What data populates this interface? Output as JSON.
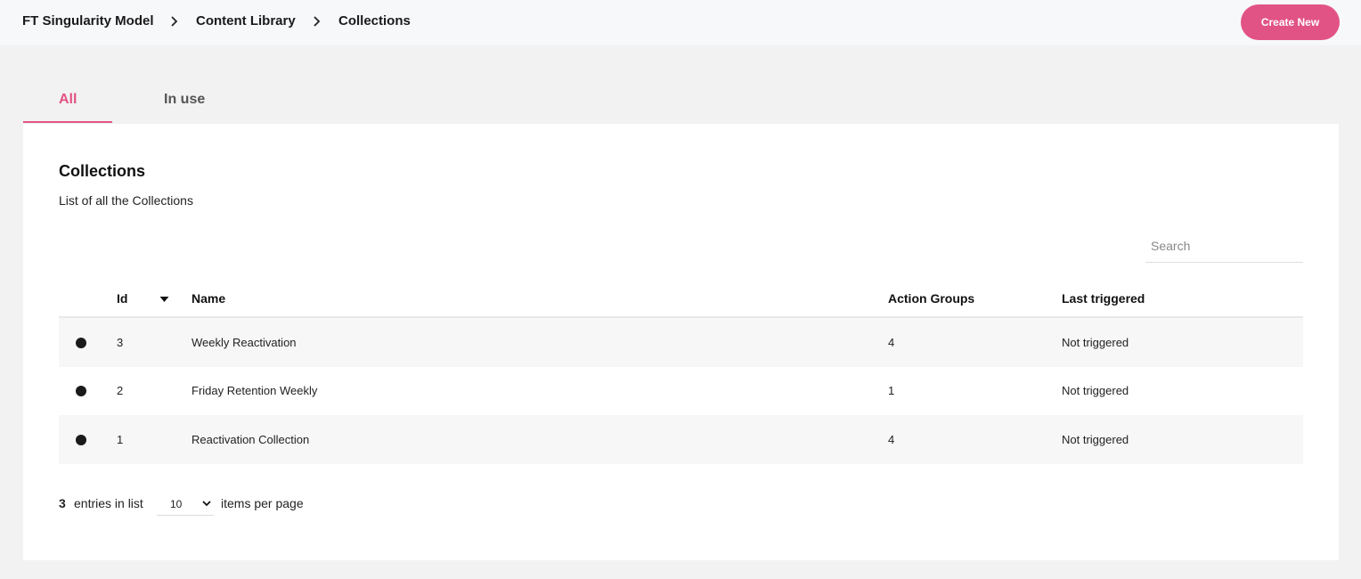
{
  "breadcrumb": {
    "items": [
      "FT Singularity Model",
      "Content Library",
      "Collections"
    ]
  },
  "header": {
    "create_label": "Create New"
  },
  "tabs": [
    {
      "label": "All",
      "active": true
    },
    {
      "label": "In use",
      "active": false
    }
  ],
  "main": {
    "title": "Collections",
    "subtitle": "List of all the Collections",
    "search_placeholder": "Search"
  },
  "table": {
    "columns": [
      "Id",
      "Name",
      "Action Groups",
      "Last triggered"
    ],
    "sort_icon": "caret-down-icon",
    "rows": [
      {
        "id": "3",
        "name": "Weekly Reactivation",
        "action_groups": "4",
        "last_triggered": "Not triggered"
      },
      {
        "id": "2",
        "name": "Friday Retention Weekly",
        "action_groups": "1",
        "last_triggered": "Not triggered"
      },
      {
        "id": "1",
        "name": "Reactivation Collection",
        "action_groups": "4",
        "last_triggered": "Not triggered"
      }
    ]
  },
  "footer": {
    "count": "3",
    "entries_label": "entries in list",
    "per_page": "10",
    "items_label": "items per page"
  },
  "colors": {
    "accent": "#e25385",
    "status_dot": "#1a1a1a"
  }
}
